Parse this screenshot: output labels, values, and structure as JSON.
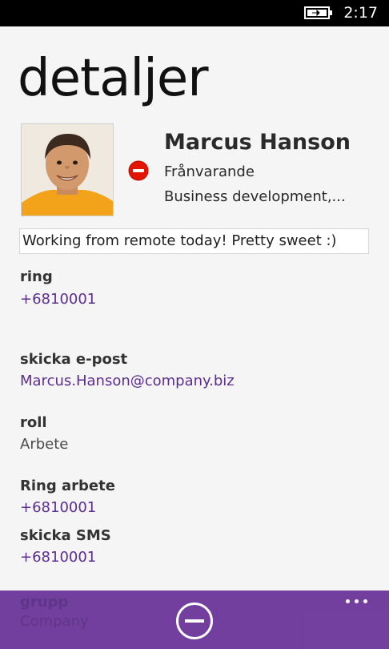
{
  "status_bar": {
    "time": "2:17",
    "icons": [
      "battery-charging-icon"
    ]
  },
  "page": {
    "title": "detaljer"
  },
  "contact": {
    "name": "Marcus Hanson",
    "presence": "Frånvarande",
    "presence_icon": "do-not-disturb-icon",
    "presence_color": "#e51400",
    "job_title": "Business development,...",
    "status_message": "Working from remote today! Pretty sweet :)"
  },
  "fields": {
    "call": {
      "label": "ring",
      "value": "+6810001"
    },
    "email": {
      "label": "skicka e-post",
      "value": "Marcus.Hanson@company.biz"
    },
    "role": {
      "label": "roll",
      "value": "Arbete"
    },
    "call_work": {
      "label": "Ring arbete",
      "value": "+6810001"
    },
    "sms": {
      "label": "skicka SMS",
      "value": "+6810001"
    },
    "group": {
      "label": "grupp",
      "value": "Company"
    }
  },
  "app_bar": {
    "icons": [
      "remove-circle-icon",
      "more-ellipsis-icon"
    ],
    "accent_color": "#6f3a9c"
  },
  "colors": {
    "link": "#5c2d91",
    "background": "#f5f5f5"
  }
}
